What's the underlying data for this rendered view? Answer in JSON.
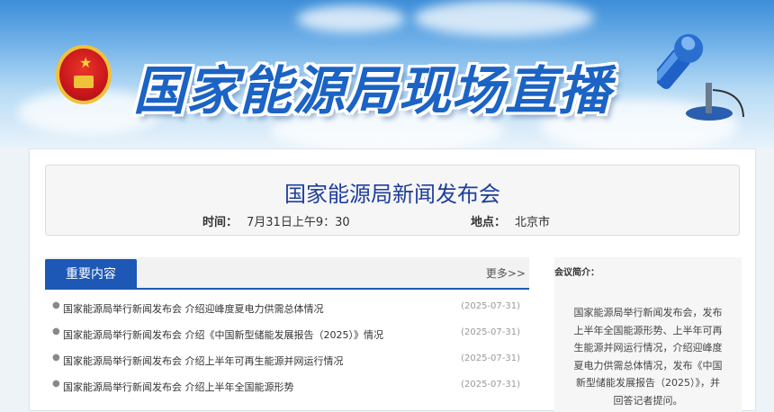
{
  "banner": {
    "title": "国家能源局现场直播"
  },
  "conference": {
    "title": "国家能源局新闻发布会",
    "time_label": "时间：",
    "time_value": "7月31日上午9：30",
    "place_label": "地点：",
    "place_value": "北京市"
  },
  "news": {
    "tab_label": "重要内容",
    "more_label": "更多>>",
    "items": [
      {
        "title": "国家能源局举行新闻发布会 介绍迎峰度夏电力供需总体情况",
        "date": "(2025-07-31)"
      },
      {
        "title": "国家能源局举行新闻发布会 介绍《中国新型储能发展报告（2025）》情况",
        "date": "(2025-07-31)"
      },
      {
        "title": "国家能源局举行新闻发布会 介绍上半年可再生能源并网运行情况",
        "date": "(2025-07-31)"
      },
      {
        "title": "国家能源局举行新闻发布会 介绍上半年全国能源形势",
        "date": "(2025-07-31)"
      }
    ]
  },
  "intro": {
    "label": "会议简介：",
    "text": "国家能源局举行新闻发布会，发布上半年全国能源形势、上半年可再生能源并网运行情况，介绍迎峰度夏电力供需总体情况，发布《中国新型储能发展报告（2025）》，并回答记者提问。"
  },
  "colors": {
    "accent": "#1e58b6",
    "title_blue": "#1f3e9c",
    "emblem_red": "#c9161b"
  },
  "icons": {
    "emblem": "national-emblem-icon",
    "microphone": "microphone-icon",
    "bullet": "bullet-icon"
  }
}
